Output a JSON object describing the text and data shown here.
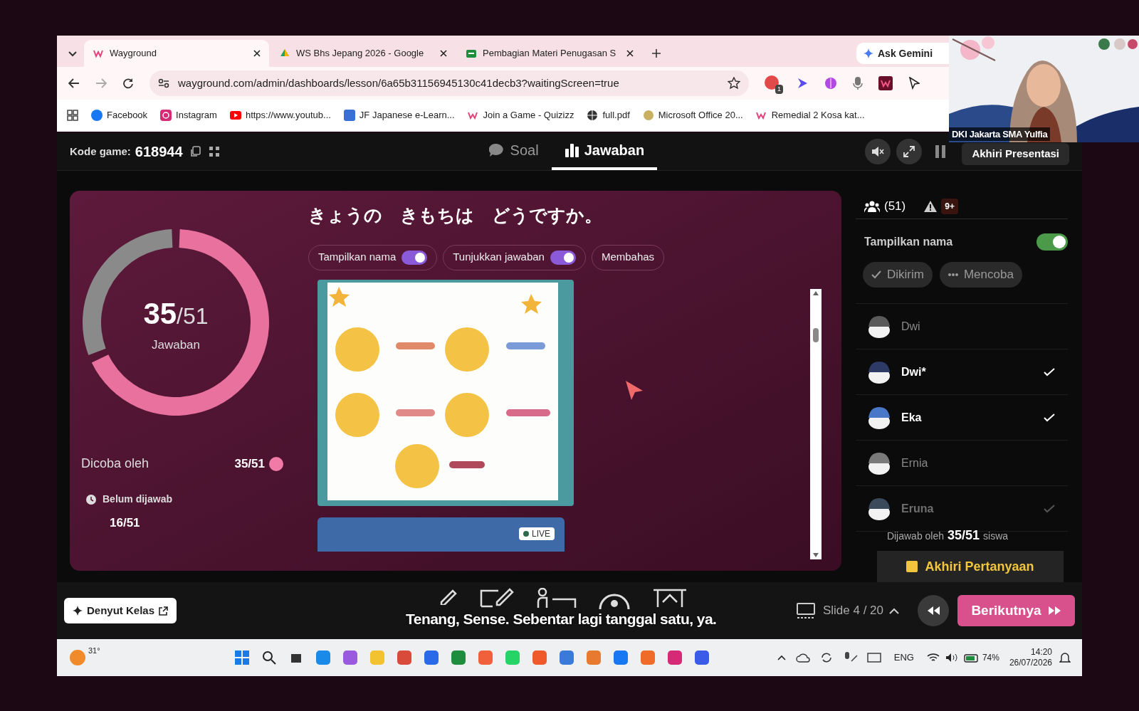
{
  "browser": {
    "tabs": [
      {
        "title": "Wayground",
        "selected": true
      },
      {
        "title": "WS Bhs Jepang 2026 - Google",
        "selected": false
      },
      {
        "title": "Pembagian Materi Penugasan S",
        "selected": false
      }
    ],
    "ask_gemini": "Ask Gemini",
    "url": "wayground.com/admin/dashboards/lesson/6a65b31156945130c41decb3?waitingScreen=true",
    "extension_badge": "1",
    "bookmarks": [
      "Facebook",
      "Instagram",
      "https://www.youtub...",
      "JF Japanese e-Learn...",
      "Join a Game - Quizizz",
      "full.pdf",
      "Microsoft Office 20...",
      "Remedial 2 Kosa kat..."
    ]
  },
  "video": {
    "caption": "DKI Jakarta SMA Yulfia"
  },
  "header": {
    "game_code_label": "Kode game:",
    "game_code": "618944",
    "tabs": [
      {
        "label": "Soal",
        "selected": false
      },
      {
        "label": "Jawaban",
        "selected": true
      }
    ],
    "end_button": "Akhiri Presentasi"
  },
  "summary": {
    "answered": "35",
    "total": "/51",
    "label": "Jawaban",
    "chart_data": {
      "type": "donut",
      "values": [
        68.6,
        31.4
      ]
    },
    "attempted_label": "Dicoba oleh",
    "attempted": "35/51",
    "unanswered_label": "Belum dijawab",
    "unanswered": "16/51"
  },
  "question": {
    "text": "きょうの　きもちは　どうですか。",
    "toggles": [
      {
        "label": "Tampilkan nama",
        "on": true
      },
      {
        "label": "Tunjukkan jawaban",
        "on": true
      }
    ],
    "discuss": "Membahas",
    "live_badge": "LIVE"
  },
  "panel": {
    "participants": "(51)",
    "alerts": "9+",
    "show_names": {
      "label": "Tampilkan nama",
      "on": true
    },
    "filters": [
      {
        "label": "Dikirim",
        "kind": "submitted"
      },
      {
        "label": "Mencoba",
        "kind": "trying"
      }
    ],
    "students": [
      {
        "name": "Dwi",
        "answered": false,
        "color": "#5a5a5a"
      },
      {
        "name": "Dwi*",
        "answered": true,
        "color": "#2e3a66"
      },
      {
        "name": "Eka",
        "answered": true,
        "color": "#4a78c8"
      },
      {
        "name": "Ernia",
        "answered": false,
        "color": "#7a7a7a"
      },
      {
        "name": "Eruna",
        "answered": true,
        "color": "#3a4a5a"
      }
    ],
    "answered_prefix": "Dijawab oleh",
    "answered_count": "35/51",
    "answered_suffix": "siswa",
    "end_question": "Akhiri Pertanyaan"
  },
  "footer": {
    "pulse": "Denyut Kelas",
    "slide": "Slide 4 / 20",
    "next": "Berikutnya"
  },
  "caption": "Tenang, Sense. Sebentar lagi tanggal satu, ya.",
  "taskbar": {
    "temperature": "31°",
    "language": "ENG",
    "battery": "74%",
    "time": "14:20",
    "date": "26/07/2026"
  }
}
